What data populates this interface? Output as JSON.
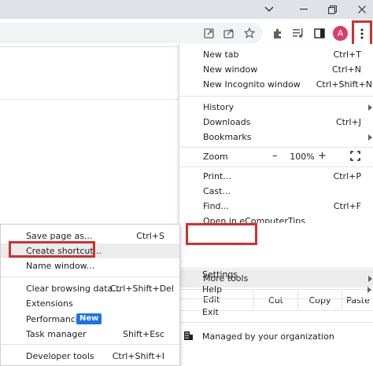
{
  "window": {
    "minimize_glyph": "⌄",
    "restore_glyph": "❐"
  },
  "toolbar": {
    "avatar_letter": "A",
    "icons": [
      "open-in-app-icon",
      "share-icon",
      "bookmark-star-icon",
      "extensions-icon",
      "media-controls-icon",
      "side-panel-icon",
      "kebab-menu-icon"
    ]
  },
  "menu": {
    "new_tab": {
      "label": "New tab",
      "shortcut": "Ctrl+T"
    },
    "new_window": {
      "label": "New window",
      "shortcut": "Ctrl+N"
    },
    "new_incognito": {
      "label": "New Incognito window",
      "shortcut": "Ctrl+Shift+N"
    },
    "history": {
      "label": "History"
    },
    "downloads": {
      "label": "Downloads",
      "shortcut": "Ctrl+J"
    },
    "bookmarks": {
      "label": "Bookmarks"
    },
    "zoom": {
      "label": "Zoom",
      "minus": "–",
      "value": "100%",
      "plus": "+"
    },
    "print": {
      "label": "Print...",
      "shortcut": "Ctrl+P"
    },
    "cast": {
      "label": "Cast..."
    },
    "find": {
      "label": "Find...",
      "shortcut": "Ctrl+F"
    },
    "open_in": {
      "label": "Open in eComputerTips"
    },
    "more_tools": {
      "label": "More tools"
    },
    "edit": {
      "label": "Edit",
      "cut": "Cut",
      "copy": "Copy",
      "paste": "Paste"
    },
    "settings": {
      "label": "Settings"
    },
    "help": {
      "label": "Help"
    },
    "exit": {
      "label": "Exit"
    },
    "managed": {
      "label": "Managed by your organization"
    }
  },
  "submenu": {
    "save_page": {
      "label": "Save page as...",
      "shortcut": "Ctrl+S"
    },
    "create_shortcut": {
      "label": "Create shortcut..."
    },
    "name_window": {
      "label": "Name window..."
    },
    "clear_browsing": {
      "label": "Clear browsing data...",
      "shortcut": "Ctrl+Shift+Del"
    },
    "extensions": {
      "label": "Extensions"
    },
    "performance": {
      "label": "Performance",
      "badge": "New"
    },
    "task_manager": {
      "label": "Task manager",
      "shortcut": "Shift+Esc"
    },
    "developer_tools": {
      "label": "Developer tools",
      "shortcut": "Ctrl+Shift+I"
    }
  },
  "colors": {
    "highlight_box": "#d32f2f",
    "badge": "#1a73e8",
    "avatar": "#d93d6a"
  }
}
